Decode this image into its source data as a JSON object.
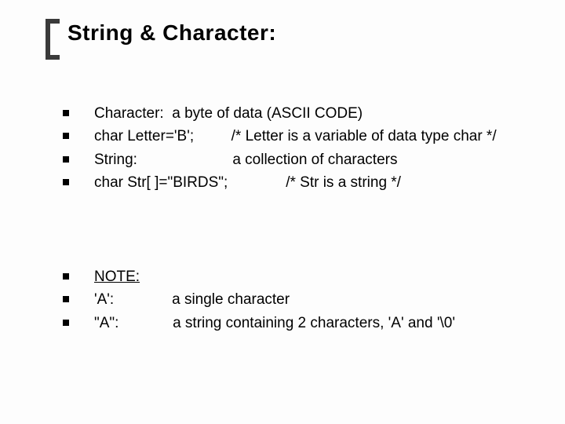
{
  "title": "String & Character:",
  "group1": {
    "b1": "Character:  a byte of data (ASCII CODE)",
    "b2": "char Letter='B';         /* Letter is a variable of data type char */",
    "b3": "String:                       a collection of characters",
    "b4": "char Str[ ]=\"BIRDS\";              /* Str is a string */"
  },
  "group2": {
    "b5_label": "NOTE:",
    "b6": "'A':              a single character",
    "b7": "\"A\":             a string containing 2 characters, 'A' and '\\0'"
  }
}
